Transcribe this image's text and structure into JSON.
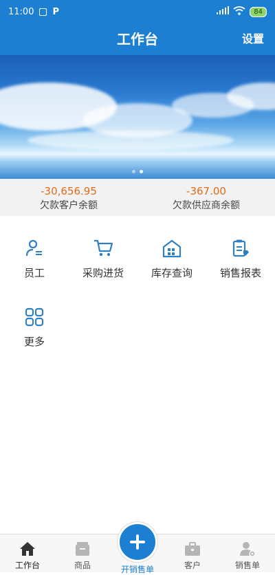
{
  "status_bar": {
    "time": "11:00",
    "battery": "84"
  },
  "header": {
    "title": "工作台",
    "settings_label": "设置"
  },
  "summary": [
    {
      "value": "-30,656.95",
      "label": "欠款客户余额"
    },
    {
      "value": "-367.00",
      "label": "欠款供应商余额"
    }
  ],
  "grid": [
    {
      "label": "员工",
      "icon": "employee-icon"
    },
    {
      "label": "采购进货",
      "icon": "shopping-cart-icon"
    },
    {
      "label": "库存查询",
      "icon": "warehouse-icon"
    },
    {
      "label": "销售报表",
      "icon": "report-icon"
    },
    {
      "label": "更多",
      "icon": "more-grid-icon"
    }
  ],
  "tabbar": [
    {
      "label": "工作台",
      "icon": "home-icon",
      "active": true
    },
    {
      "label": "商品",
      "icon": "box-icon"
    },
    {
      "label": "开销售单",
      "icon": "plus-icon"
    },
    {
      "label": "客户",
      "icon": "briefcase-icon"
    },
    {
      "label": "销售单",
      "icon": "user-gear-icon"
    }
  ],
  "colors": {
    "primary": "#1c7fd1",
    "amount": "#e06c1a",
    "icon": "#2f7fc1"
  }
}
